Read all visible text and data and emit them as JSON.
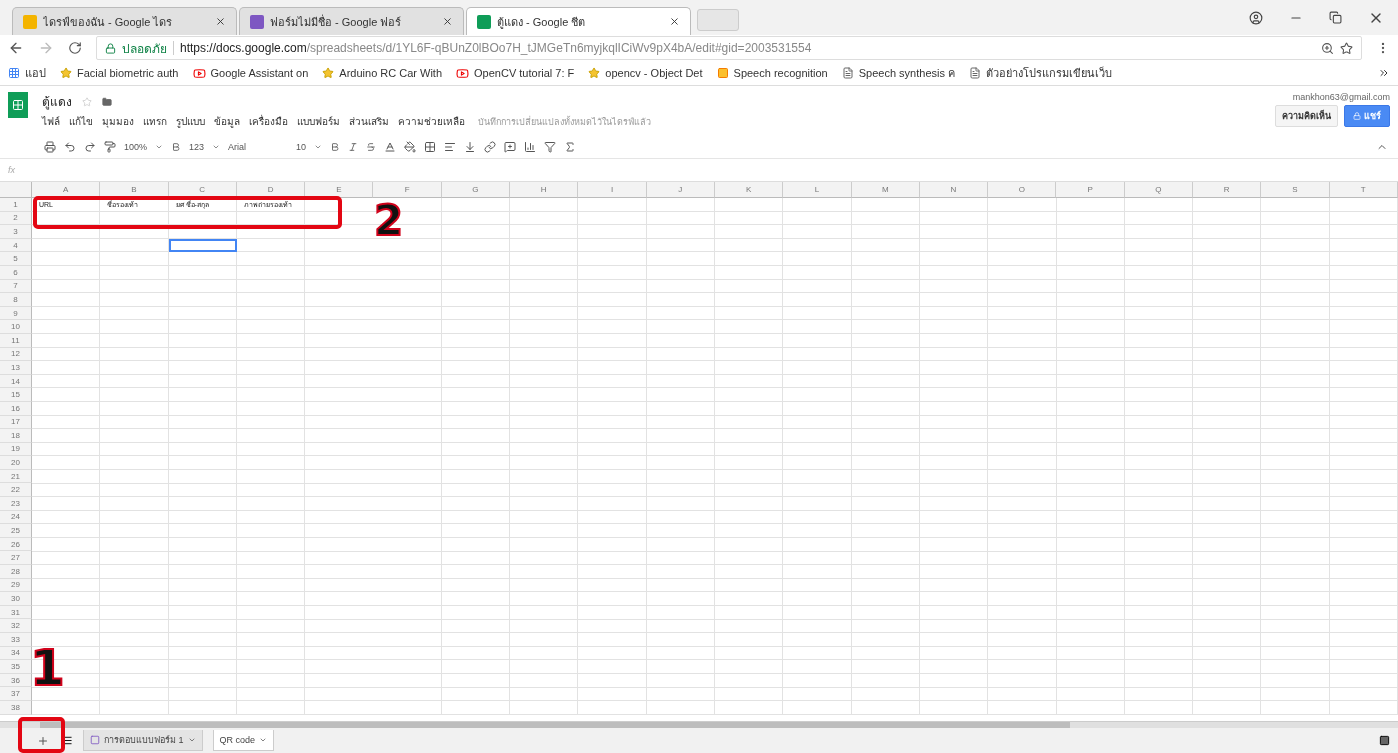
{
  "browser_tabs": [
    {
      "title": "ไดรฟ์ของฉัน - Google ไดร",
      "selected": false,
      "color": "#f4b400"
    },
    {
      "title": "ฟอร์มไม่มีชื่อ - Google ฟอร์",
      "selected": false,
      "color": "#7e57c2"
    },
    {
      "title": "ตู้แดง - Google ชีต",
      "selected": true,
      "color": "#0f9d58"
    }
  ],
  "address_bar": {
    "security": "ปลอดภัย",
    "host": "https://docs.google.com",
    "path": "/spreadsheets/d/1YL6F-qBUnZ0lBOo7H_tJMGeTn6myjkqlICiWv9pX4bA/edit#gid=2003531554"
  },
  "bookmarks": [
    {
      "label": "แอป",
      "kind": "apps"
    },
    {
      "label": "Facial biometric auth",
      "kind": "site"
    },
    {
      "label": "Google Assistant on",
      "kind": "video"
    },
    {
      "label": "Arduino RC Car With",
      "kind": "site"
    },
    {
      "label": "OpenCV tutorial 7: F",
      "kind": "video"
    },
    {
      "label": "opencv - Object Det",
      "kind": "site"
    },
    {
      "label": "Speech recognition",
      "kind": "blog"
    },
    {
      "label": "Speech synthesis ค",
      "kind": "page"
    },
    {
      "label": "ตัวอย่างโปรแกรมเขียนเว็บ",
      "kind": "page"
    }
  ],
  "document": {
    "title": "ตู้แดง",
    "account": "mankhon63@gmail.com",
    "save_status": "บันทึกการเปลี่ยนแปลงทั้งหมดไว้ในไดรฟ์แล้ว",
    "comments_button": "ความคิดเห็น",
    "share_button": "แชร์"
  },
  "menu": [
    "ไฟล์",
    "แก้ไข",
    "มุมมอง",
    "แทรก",
    "รูปแบบ",
    "ข้อมูล",
    "เครื่องมือ",
    "แบบฟอร์ม",
    "ส่วนเสริม",
    "ความช่วยเหลือ"
  ],
  "toolbar": {
    "zoom": "100%",
    "number_format": "123",
    "font": "Arial",
    "font_size": "10"
  },
  "formula_bar": {
    "label": "fx"
  },
  "columns": [
    "A",
    "B",
    "C",
    "D",
    "E",
    "F",
    "G",
    "H",
    "I",
    "J",
    "K",
    "L",
    "M",
    "N",
    "O",
    "P",
    "Q",
    "R",
    "S",
    "T"
  ],
  "rows": [
    {
      "number": "1",
      "cells": [
        "URL",
        "ชื่อรองเท้า",
        "ยศ ชื่อ-สกุล",
        "ภาพถ่ายรองเท้า"
      ]
    },
    {
      "number": "2"
    },
    {
      "number": "3"
    },
    {
      "number": "4",
      "cells": [
        {
          "selected": false
        },
        {
          "selected": false
        },
        {
          "selected": true
        }
      ]
    },
    {
      "number": "5"
    },
    {
      "number": "6"
    },
    {
      "number": "7"
    },
    {
      "number": "8"
    },
    {
      "number": "9"
    },
    {
      "number": "10"
    },
    {
      "number": "11"
    },
    {
      "number": "12"
    },
    {
      "number": "13"
    },
    {
      "number": "14"
    },
    {
      "number": "15"
    },
    {
      "number": "16"
    },
    {
      "number": "17"
    },
    {
      "number": "18"
    },
    {
      "number": "19"
    },
    {
      "number": "20"
    },
    {
      "number": "21"
    },
    {
      "number": "22"
    },
    {
      "number": "23"
    },
    {
      "number": "24"
    },
    {
      "number": "25"
    },
    {
      "number": "26"
    },
    {
      "number": "27"
    },
    {
      "number": "28"
    },
    {
      "number": "29"
    },
    {
      "number": "30"
    },
    {
      "number": "31"
    },
    {
      "number": "32"
    },
    {
      "number": "33"
    },
    {
      "number": "34"
    },
    {
      "number": "35"
    },
    {
      "number": "36"
    },
    {
      "number": "37"
    },
    {
      "number": "38"
    }
  ],
  "sheet_tabs": [
    {
      "label": "การตอบแบบฟอร์ม 1",
      "selected": false,
      "kind": "form"
    },
    {
      "label": "QR code",
      "selected": true,
      "kind": "plain"
    }
  ],
  "annotations": [
    {
      "label": "2"
    },
    {
      "label": "1"
    }
  ]
}
